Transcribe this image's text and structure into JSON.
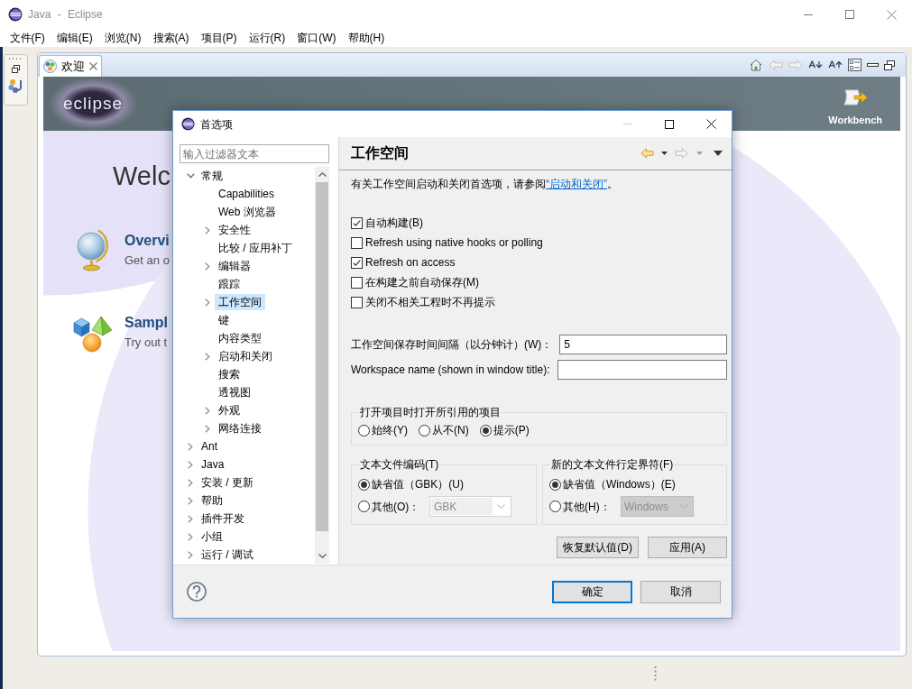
{
  "window": {
    "title": "Java - Eclipse"
  },
  "menu": [
    "文件(F)",
    "编辑(E)",
    "浏览(N)",
    "搜索(A)",
    "项目(P)",
    "运行(R)",
    "窗口(W)",
    "帮助(H)"
  ],
  "editor": {
    "tabs": [
      {
        "label": "欢迎",
        "selected": true
      }
    ],
    "welcome": {
      "logo": "eclipse",
      "workbench": "Workbench",
      "heading": "Welc",
      "items": [
        {
          "kind": "overview",
          "title": "Overvi",
          "description": "Get an o"
        },
        {
          "kind": "samples",
          "title": "Sampl",
          "description": "Try out t"
        }
      ]
    }
  },
  "dialog": {
    "title": "首选项",
    "filter": {
      "placeholder": "输入过滤器文本"
    },
    "tree": [
      {
        "label": "常规",
        "expanded": true,
        "selected": false,
        "children": [
          {
            "label": "Capabilities",
            "selected": false
          },
          {
            "label": "Web 浏览器",
            "selected": false
          },
          {
            "label": "安全性",
            "expanded": false,
            "selected": false
          },
          {
            "label": "比较 / 应用补丁",
            "selected": false
          },
          {
            "label": "编辑器",
            "expanded": false,
            "selected": false
          },
          {
            "label": "跟踪",
            "selected": false
          },
          {
            "label": "工作空间",
            "expanded": false,
            "selected": true
          },
          {
            "label": "键",
            "selected": false
          },
          {
            "label": "内容类型",
            "selected": false
          },
          {
            "label": "启动和关闭",
            "expanded": false,
            "selected": false
          },
          {
            "label": "搜索",
            "selected": false
          },
          {
            "label": "透视图",
            "selected": false
          },
          {
            "label": "外观",
            "expanded": false,
            "selected": false
          },
          {
            "label": "网络连接",
            "expanded": false,
            "selected": false
          }
        ]
      },
      {
        "label": "Ant",
        "expanded": false,
        "selected": false
      },
      {
        "label": "Java",
        "expanded": false,
        "selected": false
      },
      {
        "label": "安装 / 更新",
        "expanded": false,
        "selected": false
      },
      {
        "label": "帮助",
        "expanded": false,
        "selected": false
      },
      {
        "label": "插件开发",
        "expanded": false,
        "selected": false
      },
      {
        "label": "小组",
        "expanded": false,
        "selected": false
      },
      {
        "label": "运行 / 调试",
        "expanded": false,
        "selected": false
      }
    ],
    "page": {
      "title": "工作空间",
      "description": {
        "text": "有关工作空间启动和关闭首选项，请参阅",
        "link": "“启动和关闭”",
        "end": "。"
      },
      "checkboxes": [
        {
          "label": "自动构建(B)",
          "checked": true
        },
        {
          "label": "Refresh using native hooks or polling",
          "checked": false
        },
        {
          "label": "Refresh on access",
          "checked": true
        },
        {
          "label": "在构建之前自动保存(M)",
          "checked": false
        },
        {
          "label": "关闭不相关工程时不再提示",
          "checked": false
        }
      ],
      "fields": [
        {
          "label": "工作空间保存时间间隔（以分钟计）(W)：",
          "value": "5"
        },
        {
          "label": "Workspace name (shown in window title):"
        }
      ],
      "project_group": {
        "title": "打开项目时打开所引用的项目",
        "options": [
          {
            "label": "始终(Y)",
            "selected": false
          },
          {
            "label": "从不(N)",
            "selected": false
          },
          {
            "label": "提示(P)",
            "selected": true
          }
        ]
      },
      "encoding_groups": [
        {
          "title": "文本文件编码(T)",
          "options": [
            {
              "label": "缺省值（GBK）(U)",
              "selected": true
            },
            {
              "label": "其他(O)：",
              "selected": false,
              "combo": {
                "value": "GBK",
                "kind": "editable",
                "disabled": true
              }
            }
          ]
        },
        {
          "title": "新的文本文件行定界符(F)",
          "options": [
            {
              "label": "缺省值（Windows）(E)",
              "selected": true
            },
            {
              "label": "其他(H)：",
              "selected": false,
              "combo": {
                "value": "Windows",
                "kind": "readonly",
                "disabled": true
              }
            }
          ]
        }
      ],
      "page_buttons": [
        "恢复默认值(D)",
        "应用(A)"
      ]
    },
    "buttons": [
      {
        "label": "确定",
        "default": true
      },
      {
        "label": "取消",
        "default": false
      }
    ]
  }
}
